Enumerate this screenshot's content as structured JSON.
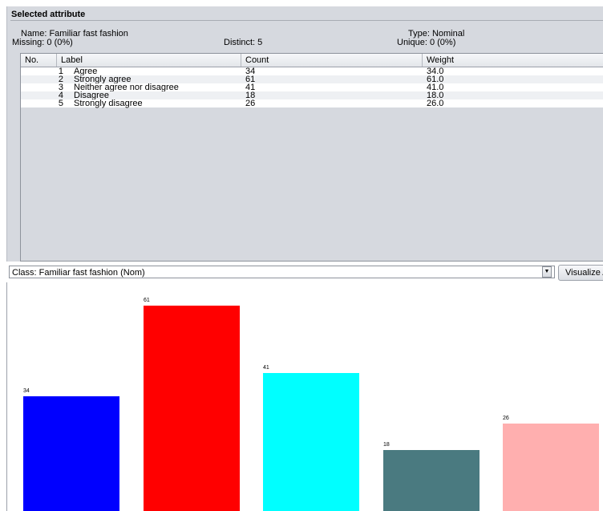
{
  "panel": {
    "title": "Selected attribute",
    "name": "Name: Familiar fast fashion",
    "type": "Type: Nominal",
    "missing": "Missing: 0 (0%)",
    "distinct": "Distinct: 5",
    "unique": "Unique: 0 (0%)"
  },
  "table": {
    "headers": [
      "No.",
      "Label",
      "Count",
      "Weight"
    ],
    "rows": [
      {
        "no": "1",
        "label": "Agree",
        "count": "34",
        "weight": "34.0"
      },
      {
        "no": "2",
        "label": "Strongly agree",
        "count": "61",
        "weight": "61.0"
      },
      {
        "no": "3",
        "label": "Neither agree nor disagree",
        "count": "41",
        "weight": "41.0"
      },
      {
        "no": "4",
        "label": "Disagree",
        "count": "18",
        "weight": "18.0"
      },
      {
        "no": "5",
        "label": "Strongly disagree",
        "count": "26",
        "weight": "26.0"
      }
    ]
  },
  "class_selector": {
    "value": "Class: Familiar fast fashion (Nom)",
    "button": "Visualize All"
  },
  "chart_data": {
    "type": "bar",
    "categories": [
      "Agree",
      "Strongly agree",
      "Neither agree nor disagree",
      "Disagree",
      "Strongly disagree"
    ],
    "values": [
      34,
      61,
      41,
      18,
      26
    ],
    "value_labels": [
      "34",
      "61",
      "41",
      "18",
      "26"
    ],
    "colors": [
      "#0000ff",
      "#ff0000",
      "#00ffff",
      "#4a7a80",
      "#ffafaf"
    ],
    "title": "",
    "xlabel": "",
    "ylabel": ""
  }
}
